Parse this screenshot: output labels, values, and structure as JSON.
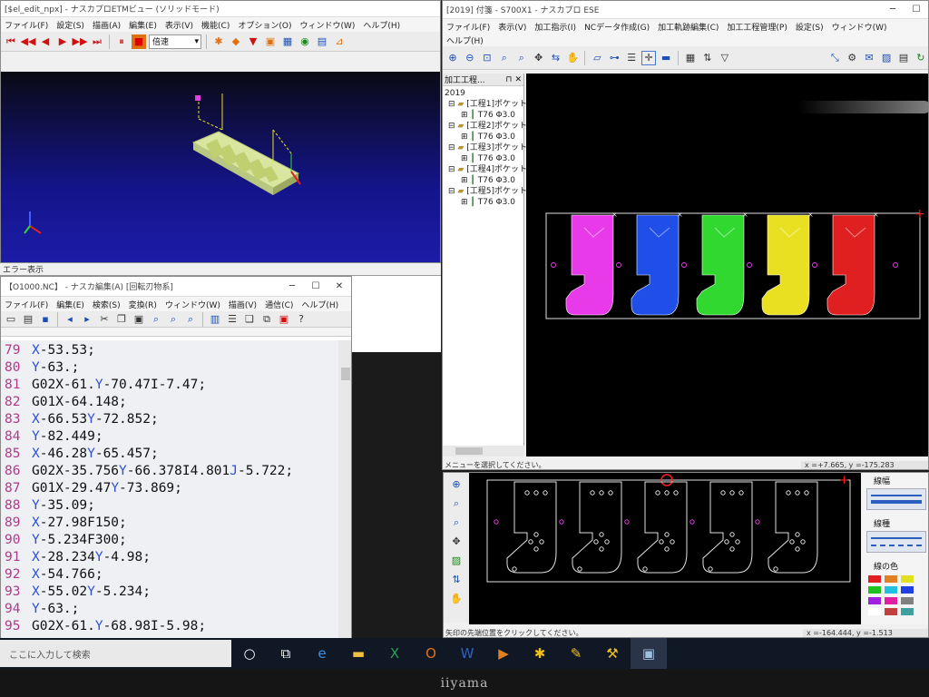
{
  "solid_window": {
    "title": "[$el_edit_npx] - ナスカプロETMビュー (ソリッドモード)",
    "menu": [
      "ファイル(F)",
      "設定(S)",
      "描画(A)",
      "編集(E)",
      "表示(V)",
      "機能(C)",
      "オプション(O)",
      "ウィンドウ(W)",
      "ヘルプ(H)"
    ],
    "speed_value": "倍速"
  },
  "error_label": "エラー表示",
  "editor_window": {
    "title": "【O1000.NC】 - ナスカ編集(A) [回転刃物系]",
    "menu": [
      "ファイル(F)",
      "編集(E)",
      "検索(S)",
      "変換(R)",
      "ウィンドウ(W)",
      "描画(V)",
      "通信(C)",
      "ヘルプ(H)"
    ],
    "lines": [
      {
        "n": "79",
        "segs": [
          {
            "t": "X",
            "c": "ltr"
          },
          {
            "t": "-53.53;",
            "c": ""
          }
        ]
      },
      {
        "n": "80",
        "segs": [
          {
            "t": "Y",
            "c": "ltr"
          },
          {
            "t": "-63.;",
            "c": ""
          }
        ]
      },
      {
        "n": "81",
        "segs": [
          {
            "t": "G02X",
            "c": ""
          },
          {
            "t": "-61.",
            "c": ""
          },
          {
            "t": "Y",
            "c": "ltr"
          },
          {
            "t": "-70.47I-7.47;",
            "c": ""
          }
        ]
      },
      {
        "n": "82",
        "segs": [
          {
            "t": "G01X",
            "c": ""
          },
          {
            "t": "-64.148;",
            "c": ""
          }
        ]
      },
      {
        "n": "83",
        "segs": [
          {
            "t": "X",
            "c": "ltr"
          },
          {
            "t": "-66.53",
            "c": ""
          },
          {
            "t": "Y",
            "c": "ltr"
          },
          {
            "t": "-72.852;",
            "c": ""
          }
        ]
      },
      {
        "n": "84",
        "segs": [
          {
            "t": "Y",
            "c": "ltr"
          },
          {
            "t": "-82.449;",
            "c": ""
          }
        ]
      },
      {
        "n": "85",
        "segs": [
          {
            "t": "X",
            "c": "ltr"
          },
          {
            "t": "-46.28",
            "c": ""
          },
          {
            "t": "Y",
            "c": "ltr"
          },
          {
            "t": "-65.457;",
            "c": ""
          }
        ]
      },
      {
        "n": "86",
        "segs": [
          {
            "t": "G02X",
            "c": ""
          },
          {
            "t": "-35.756",
            "c": ""
          },
          {
            "t": "Y",
            "c": "ltr"
          },
          {
            "t": "-66.378I4.801",
            "c": ""
          },
          {
            "t": "J",
            "c": "ltr"
          },
          {
            "t": "-5.722;",
            "c": ""
          }
        ]
      },
      {
        "n": "87",
        "segs": [
          {
            "t": "G01X",
            "c": ""
          },
          {
            "t": "-29.47",
            "c": ""
          },
          {
            "t": "Y",
            "c": "ltr"
          },
          {
            "t": "-73.869;",
            "c": ""
          }
        ]
      },
      {
        "n": "88",
        "segs": [
          {
            "t": "Y",
            "c": "ltr"
          },
          {
            "t": "-35.09;",
            "c": ""
          }
        ]
      },
      {
        "n": "89",
        "segs": [
          {
            "t": "X",
            "c": "ltr"
          },
          {
            "t": "-27.98F150;",
            "c": ""
          }
        ]
      },
      {
        "n": "90",
        "segs": [
          {
            "t": "Y",
            "c": "ltr"
          },
          {
            "t": "-5.234F300;",
            "c": ""
          }
        ]
      },
      {
        "n": "91",
        "segs": [
          {
            "t": "X",
            "c": "ltr"
          },
          {
            "t": "-28.234",
            "c": ""
          },
          {
            "t": "Y",
            "c": "ltr"
          },
          {
            "t": "-4.98;",
            "c": ""
          }
        ]
      },
      {
        "n": "92",
        "segs": [
          {
            "t": "X",
            "c": "ltr"
          },
          {
            "t": "-54.766;",
            "c": ""
          }
        ]
      },
      {
        "n": "93",
        "segs": [
          {
            "t": "X",
            "c": "ltr"
          },
          {
            "t": "-55.02",
            "c": ""
          },
          {
            "t": "Y",
            "c": "ltr"
          },
          {
            "t": "-5.234;",
            "c": ""
          }
        ]
      },
      {
        "n": "94",
        "segs": [
          {
            "t": "Y",
            "c": "ltr"
          },
          {
            "t": "-63.;",
            "c": ""
          }
        ]
      },
      {
        "n": "95",
        "segs": [
          {
            "t": "G02X",
            "c": ""
          },
          {
            "t": "-61.",
            "c": ""
          },
          {
            "t": "Y",
            "c": "ltr"
          },
          {
            "t": "-68.98I-5.98;",
            "c": ""
          }
        ]
      }
    ]
  },
  "cam_window": {
    "title": "[2019] 付箋 - S700X1 - ナスカプロ ESE",
    "menu_row1": [
      "ファイル(F)",
      "表示(V)",
      "加工指示(I)",
      "NCデータ作成(G)",
      "加工軌跡編集(C)",
      "加工工程管理(P)",
      "設定(S)",
      "ウィンドウ(W)"
    ],
    "menu_row2": [
      "ヘルプ(H)"
    ],
    "tree_header": "加工工程...",
    "tree_root": "2019",
    "tree": [
      {
        "proc": "[工程1]ポケット",
        "tool": "T76 Φ3.0"
      },
      {
        "proc": "[工程2]ポケット",
        "tool": "T76 Φ3.0"
      },
      {
        "proc": "[工程3]ポケット",
        "tool": "T76 Φ3.0"
      },
      {
        "proc": "[工程4]ポケット",
        "tool": "T76 Φ3.0"
      },
      {
        "proc": "[工程5]ポケット",
        "tool": "T76 Φ3.0"
      }
    ],
    "status_text": "メニューを選択してください。",
    "coords": "x =+7.665,    y =-175.283",
    "part_colors": [
      "#e83ae8",
      "#1f4fe8",
      "#30d830",
      "#e8e020",
      "#e02020"
    ]
  },
  "preview_window": {
    "status_text": "矢印の先端位置をクリックしてください。",
    "coords": "x =-164.444,    y =-1.513",
    "panel_line_width": "線幅",
    "panel_line_type": "線種",
    "panel_line_color": "線の色",
    "swatch_colors": [
      "#e02020",
      "#e08020",
      "#e0e020",
      "#20c020",
      "#20c0e0",
      "#2040e0",
      "#a020e0",
      "#e020a0",
      "#808080",
      "#ffffff",
      "#c04040",
      "#40a0a0"
    ]
  },
  "taskbar": {
    "search_placeholder": "ここに入力して検索"
  },
  "monitor_brand": "iiyama"
}
